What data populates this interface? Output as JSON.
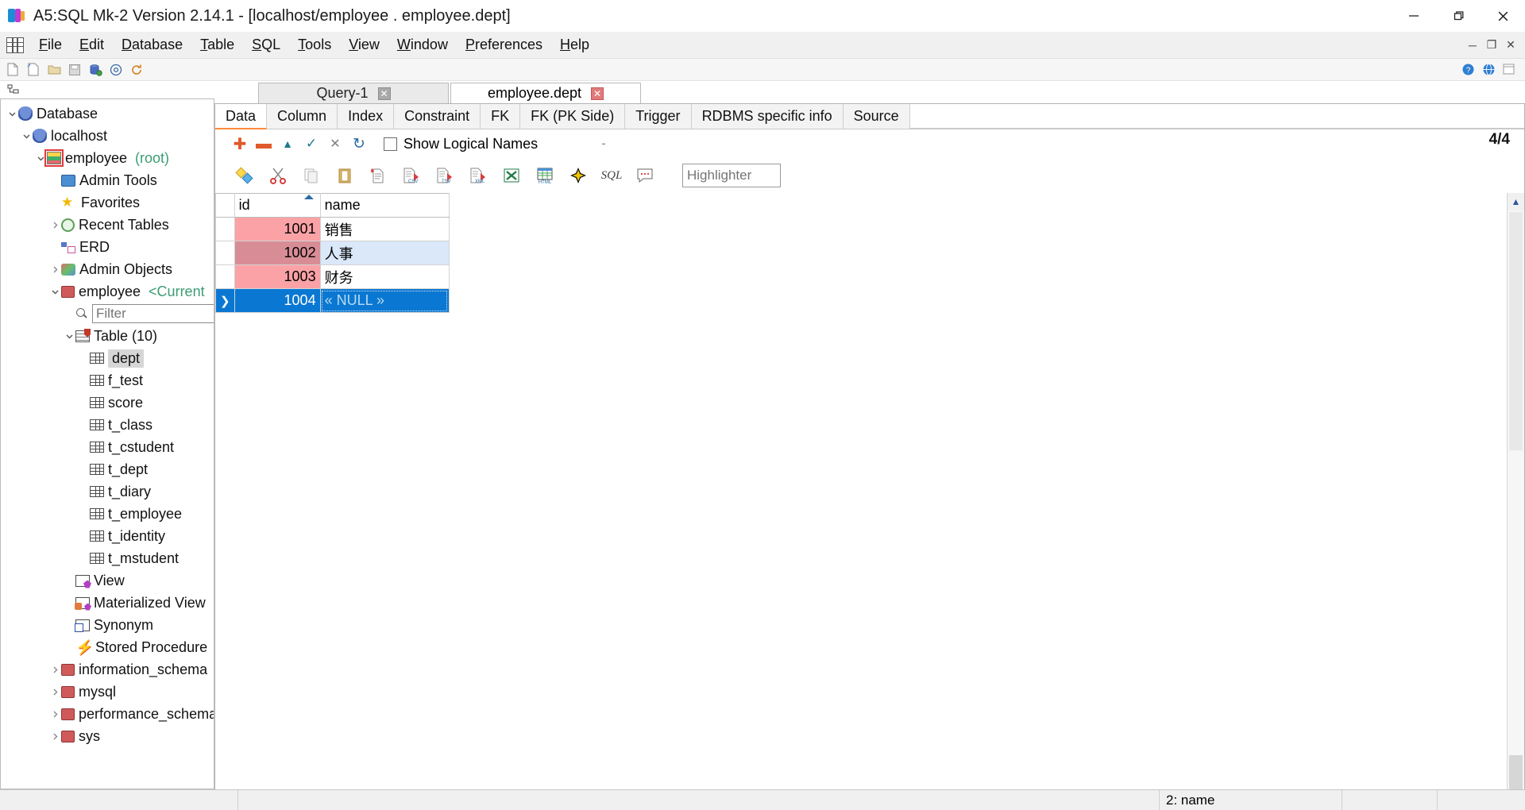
{
  "window": {
    "title": "A5:SQL Mk-2 Version 2.14.1 - [localhost/employee . employee.dept]",
    "app_icon": "a5sql-icon",
    "minimize_label": "─",
    "restore_label": "❐",
    "close_label": "✕"
  },
  "menubar": {
    "app_grid_icon": "grid-icon",
    "items": [
      {
        "label": "File",
        "accel": "F"
      },
      {
        "label": "Edit",
        "accel": "E"
      },
      {
        "label": "Database",
        "accel": "D"
      },
      {
        "label": "Table",
        "accel": "T"
      },
      {
        "label": "SQL",
        "accel": "S"
      },
      {
        "label": "Tools",
        "accel": "T"
      },
      {
        "label": "View",
        "accel": "V"
      },
      {
        "label": "Window",
        "accel": "W"
      },
      {
        "label": "Preferences",
        "accel": "P"
      },
      {
        "label": "Help",
        "accel": "H"
      }
    ],
    "mdi_minimize": "─",
    "mdi_restore": "❐",
    "mdi_close": "✕"
  },
  "main_toolbar": {
    "icons": [
      "new-document-icon",
      "open-folder-icon",
      "save-icon",
      "connect-database-icon",
      "at-sign-icon",
      "refresh-icon"
    ],
    "right_icons": [
      "help-icon",
      "web-icon",
      "window-list-icon"
    ]
  },
  "sidebar": {
    "header_icon": "tree-toggle-icon",
    "filter_placeholder": "Filter",
    "filter_value": "",
    "tree": [
      {
        "label": "Database",
        "icon": "database-icon",
        "depth": 0,
        "twisty": "expanded",
        "selected": false
      },
      {
        "label": "localhost",
        "icon": "server-icon",
        "depth": 1,
        "twisty": "expanded",
        "selected": false
      },
      {
        "label": "employee",
        "sub": "(root)",
        "icon": "connection-icon",
        "depth": 2,
        "twisty": "expanded",
        "selected": false
      },
      {
        "label": "Admin Tools",
        "icon": "monitor-icon",
        "depth": 3,
        "twisty": "none",
        "selected": false
      },
      {
        "label": "Favorites",
        "icon": "star-icon",
        "depth": 3,
        "twisty": "none",
        "selected": false
      },
      {
        "label": "Recent Tables",
        "icon": "clock-icon",
        "depth": 3,
        "twisty": "collapsed",
        "selected": false
      },
      {
        "label": "ERD",
        "icon": "erd-icon",
        "depth": 3,
        "twisty": "none",
        "selected": false
      },
      {
        "label": "Admin Objects",
        "icon": "admin-objects-icon",
        "depth": 3,
        "twisty": "collapsed",
        "selected": false
      },
      {
        "label": "employee",
        "sub": "<Current",
        "icon": "schema-icon",
        "depth": 3,
        "twisty": "expanded",
        "selected": false
      },
      {
        "label": "__FILTER__",
        "icon": "search-icon",
        "depth": 4,
        "twisty": "none",
        "selected": false
      },
      {
        "label": "Table (10)",
        "icon": "table-folder-icon",
        "depth": 4,
        "twisty": "expanded",
        "selected": false
      },
      {
        "label": "dept",
        "icon": "table-icon",
        "depth": 5,
        "twisty": "none",
        "selected": true
      },
      {
        "label": "f_test",
        "icon": "table-icon",
        "depth": 5,
        "twisty": "none",
        "selected": false
      },
      {
        "label": "score",
        "icon": "table-icon",
        "depth": 5,
        "twisty": "none",
        "selected": false
      },
      {
        "label": "t_class",
        "icon": "table-icon",
        "depth": 5,
        "twisty": "none",
        "selected": false
      },
      {
        "label": "t_cstudent",
        "icon": "table-icon",
        "depth": 5,
        "twisty": "none",
        "selected": false
      },
      {
        "label": "t_dept",
        "icon": "table-icon",
        "depth": 5,
        "twisty": "none",
        "selected": false
      },
      {
        "label": "t_diary",
        "icon": "table-icon",
        "depth": 5,
        "twisty": "none",
        "selected": false
      },
      {
        "label": "t_employee",
        "icon": "table-icon",
        "depth": 5,
        "twisty": "none",
        "selected": false
      },
      {
        "label": "t_identity",
        "icon": "table-icon",
        "depth": 5,
        "twisty": "none",
        "selected": false
      },
      {
        "label": "t_mstudent",
        "icon": "table-icon",
        "depth": 5,
        "twisty": "none",
        "selected": false
      },
      {
        "label": "View",
        "icon": "view-icon",
        "depth": 4,
        "twisty": "none",
        "selected": false
      },
      {
        "label": "Materialized View",
        "icon": "materialized-view-icon",
        "depth": 4,
        "twisty": "none",
        "selected": false
      },
      {
        "label": "Synonym",
        "icon": "synonym-icon",
        "depth": 4,
        "twisty": "none",
        "selected": false
      },
      {
        "label": "Stored Procedure",
        "icon": "stored-procedure-icon",
        "depth": 4,
        "twisty": "none",
        "selected": false
      },
      {
        "label": "information_schema",
        "icon": "schema-icon",
        "depth": 3,
        "twisty": "collapsed",
        "selected": false
      },
      {
        "label": "mysql",
        "icon": "schema-icon",
        "depth": 3,
        "twisty": "collapsed",
        "selected": false
      },
      {
        "label": "performance_schema",
        "icon": "schema-icon",
        "depth": 3,
        "twisty": "collapsed",
        "selected": false
      },
      {
        "label": "sys",
        "icon": "schema-icon",
        "depth": 3,
        "twisty": "collapsed",
        "selected": false
      }
    ],
    "hscroll_left": "◀",
    "hscroll_right": "▶"
  },
  "mdi_tabs": [
    {
      "label": "Query-1",
      "active": false,
      "close_label": "✕"
    },
    {
      "label": "employee.dept",
      "active": true,
      "close_label": "✕"
    }
  ],
  "sub_tabs": [
    {
      "label": "Data",
      "active": true
    },
    {
      "label": "Column",
      "active": false
    },
    {
      "label": "Index",
      "active": false
    },
    {
      "label": "Constraint",
      "active": false
    },
    {
      "label": "FK",
      "active": false
    },
    {
      "label": "FK (PK Side)",
      "active": false
    },
    {
      "label": "Trigger",
      "active": false
    },
    {
      "label": "RDBMS specific info",
      "active": false
    },
    {
      "label": "Source",
      "active": false
    }
  ],
  "record_toolbar": {
    "icons": [
      {
        "name": "add-record-icon",
        "glyph": "✚",
        "color": "#e05a2b"
      },
      {
        "name": "delete-record-icon",
        "glyph": "➖",
        "color": "#e05a2b"
      },
      {
        "name": "move-up-icon",
        "glyph": "▲",
        "color": "#1f7a8c"
      },
      {
        "name": "commit-icon",
        "glyph": "✓",
        "color": "#1f7a8c"
      },
      {
        "name": "rollback-icon",
        "glyph": "✕",
        "color": "#7a7a7a"
      },
      {
        "name": "refresh-data-icon",
        "glyph": "↻",
        "color": "#2b6ca3"
      }
    ],
    "show_logical_names_label": "Show Logical Names",
    "show_logical_names_checked": false,
    "separator_label": "-",
    "record_count": "4/4"
  },
  "icon_toolbar": {
    "icons": [
      "paste-cell-icon",
      "cut-icon",
      "copy-icon",
      "clipboard-icon",
      "new-document-icon",
      "export-csv-icon",
      "export-tsv-icon",
      "export-xml-icon",
      "export-excel-icon",
      "export-html-icon",
      "quick-filter-icon",
      "sql-icon",
      "comment-icon"
    ],
    "highlighter_placeholder": "Highlighter",
    "highlighter_value": ""
  },
  "grid": {
    "columns": [
      "id",
      "name"
    ],
    "sort_column": "id",
    "sort_direction": "asc",
    "rows": [
      {
        "handle": "",
        "id": "1001",
        "name": "销售",
        "style": "pink"
      },
      {
        "handle": "",
        "id": "1002",
        "name": "人事",
        "style": "pinksel"
      },
      {
        "handle": "",
        "id": "1003",
        "name": "财务",
        "style": "pink"
      },
      {
        "handle": "❯",
        "id": "1004",
        "name": "« NULL »",
        "style": "selected"
      }
    ]
  },
  "statusbar": {
    "cell1": "",
    "cell2": "2: name",
    "cell3": "",
    "cell4": ""
  },
  "colors": {
    "selection_blue": "#0a78d2",
    "pink_cell": "#fba2a6",
    "accent_orange": "#ff8a3d",
    "green_text": "#3c9d74"
  }
}
